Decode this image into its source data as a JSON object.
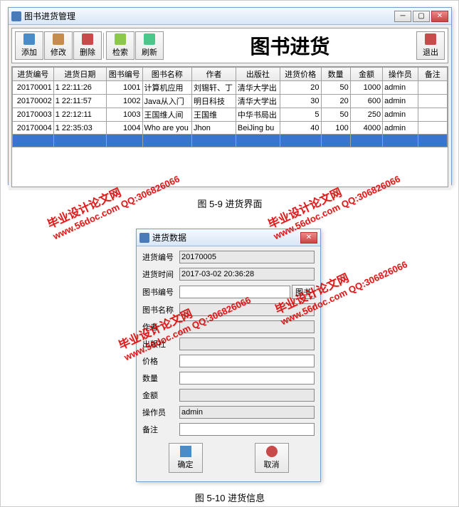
{
  "main": {
    "title": "图书进货管理",
    "pageTitle": "图书进货",
    "toolbar": {
      "add": "添加",
      "edit": "修改",
      "delete": "删除",
      "search": "检索",
      "refresh": "刷新",
      "exit": "退出"
    },
    "columns": [
      "进货编号",
      "进货日期",
      "图书编号",
      "图书名称",
      "作者",
      "出版社",
      "进货价格",
      "数量",
      "金额",
      "操作员",
      "备注"
    ],
    "rows": [
      {
        "id": "20170001",
        "date": "1 22:11:26",
        "bid": "1001",
        "bname": "计算机应用",
        "auth": "刘锡轩、丁",
        "pub": "清华大学出",
        "price": "20",
        "qty": "50",
        "total": "1000",
        "op": "admin",
        "note": ""
      },
      {
        "id": "20170002",
        "date": "1 22:11:57",
        "bid": "1002",
        "bname": "Java从入门",
        "auth": "明日科技",
        "pub": "清华大学出",
        "price": "30",
        "qty": "20",
        "total": "600",
        "op": "admin",
        "note": ""
      },
      {
        "id": "20170003",
        "date": "1 22:12:11",
        "bid": "1003",
        "bname": "王国维人间",
        "auth": "王国维",
        "pub": "中华书局出",
        "price": "5",
        "qty": "50",
        "total": "250",
        "op": "admin",
        "note": ""
      },
      {
        "id": "20170004",
        "date": "1 22:35:03",
        "bid": "1004",
        "bname": "Who are you",
        "auth": "Jhon",
        "pub": "BeiJing bu",
        "price": "40",
        "qty": "100",
        "total": "4000",
        "op": "admin",
        "note": ""
      }
    ]
  },
  "captions": {
    "fig1": "图 5-9 进货界面",
    "fig2": "图 5-10 进货信息"
  },
  "dialog": {
    "title": "进货数据",
    "fields": {
      "id_label": "进货编号",
      "id_value": "20170005",
      "time_label": "进货时间",
      "time_value": "2017-03-02 20:36:28",
      "bid_label": "图书编号",
      "bid_value": "",
      "bid_btn": "图书",
      "bname_label": "图书名称",
      "bname_value": "",
      "auth_label": "作者",
      "auth_value": "",
      "pub_label": "出版社",
      "pub_value": "",
      "price_label": "价格",
      "price_value": "",
      "qty_label": "数量",
      "qty_value": "",
      "total_label": "金额",
      "total_value": "",
      "op_label": "操作员",
      "op_value": "admin",
      "note_label": "备注",
      "note_value": ""
    },
    "ok": "确定",
    "cancel": "取消"
  },
  "watermark": {
    "line1": "毕业设计论文网",
    "line2": "www.56doc.com   QQ:306826066"
  }
}
